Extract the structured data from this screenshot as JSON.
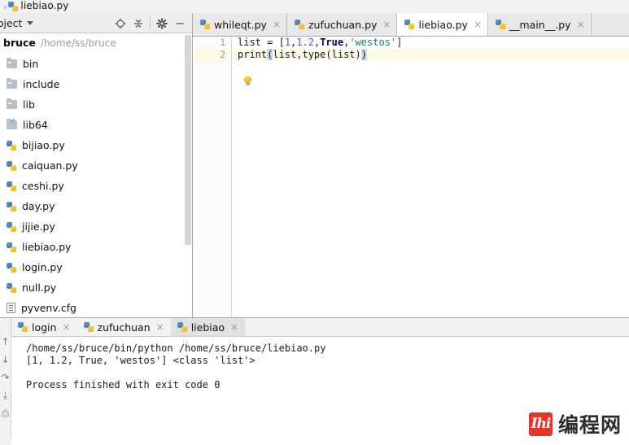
{
  "breadcrumb": {
    "separator": "›",
    "items": [
      {
        "label": "liebiao.py",
        "icon": "python-file-icon"
      }
    ]
  },
  "project_panel": {
    "title": "roject",
    "title_full": "Project",
    "tools": [
      {
        "name": "locate-icon",
        "glyph": "⊕"
      },
      {
        "name": "collapse-all-icon",
        "glyph": "⩒"
      },
      {
        "name": "settings-gear-icon",
        "glyph": "⚙"
      },
      {
        "name": "hide-panel-icon",
        "glyph": "—"
      }
    ],
    "root": {
      "name": "bruce",
      "path": "/home/ss/bruce"
    },
    "items": [
      {
        "label": "bin",
        "icon": "folder-icon"
      },
      {
        "label": "include",
        "icon": "folder-icon"
      },
      {
        "label": "lib",
        "icon": "folder-icon"
      },
      {
        "label": "lib64",
        "icon": "folder-link-icon"
      },
      {
        "label": "bijiao.py",
        "icon": "python-file-icon"
      },
      {
        "label": "caiquan.py",
        "icon": "python-file-icon"
      },
      {
        "label": "ceshi.py",
        "icon": "python-file-icon"
      },
      {
        "label": "day.py",
        "icon": "python-file-icon"
      },
      {
        "label": "jijie.py",
        "icon": "python-file-icon"
      },
      {
        "label": "liebiao.py",
        "icon": "python-file-icon"
      },
      {
        "label": "login.py",
        "icon": "python-file-icon"
      },
      {
        "label": "null.py",
        "icon": "python-file-icon"
      },
      {
        "label": "pyvenv.cfg",
        "icon": "config-file-icon"
      }
    ]
  },
  "editor": {
    "tabs": [
      {
        "label": "whileqt.py",
        "icon": "python-file-icon",
        "active": false,
        "close": "×"
      },
      {
        "label": "zufuchuan.py",
        "icon": "python-file-icon",
        "active": false,
        "close": "×"
      },
      {
        "label": "liebiao.py",
        "icon": "python-file-icon",
        "active": true,
        "close": "×"
      },
      {
        "label": "__main__.py",
        "icon": "python-file-icon",
        "active": false,
        "close": "×"
      }
    ],
    "line_numbers": [
      "1",
      "2"
    ],
    "current_line": 2,
    "lines": [
      {
        "number": "1",
        "tokens": [
          {
            "text": "list ",
            "type": "plain"
          },
          {
            "text": "= ",
            "type": "plain"
          },
          {
            "text": "[",
            "type": "plain"
          },
          {
            "text": "1",
            "type": "number"
          },
          {
            "text": ",",
            "type": "plain"
          },
          {
            "text": "1.2",
            "type": "number"
          },
          {
            "text": ",",
            "type": "plain"
          },
          {
            "text": "True",
            "type": "keyword"
          },
          {
            "text": ",",
            "type": "plain"
          },
          {
            "text": "'westos'",
            "type": "string"
          },
          {
            "text": "]",
            "type": "plain"
          }
        ]
      },
      {
        "number": "2",
        "tokens": [
          {
            "text": "print",
            "type": "plain"
          },
          {
            "text": "(",
            "type": "bracket"
          },
          {
            "text": "list,type",
            "type": "plain"
          },
          {
            "text": "(",
            "type": "plain"
          },
          {
            "text": "list",
            "type": "plain"
          },
          {
            "text": ")",
            "type": "plain"
          },
          {
            "text": ")",
            "type": "bracket"
          }
        ]
      }
    ],
    "intention_bulb": {
      "name": "intention-bulb-icon"
    }
  },
  "console": {
    "tabs": [
      {
        "label": "login",
        "icon": "python-run-icon",
        "active": false,
        "close": "×"
      },
      {
        "label": "zufuchuan",
        "icon": "python-run-icon",
        "active": false,
        "close": "×"
      },
      {
        "label": "liebiao",
        "icon": "python-run-icon",
        "active": true,
        "close": "×"
      }
    ],
    "sidebar_icons": [
      {
        "name": "scroll-up-icon",
        "glyph": "↑"
      },
      {
        "name": "scroll-down-icon",
        "glyph": "↓"
      },
      {
        "name": "soft-wrap-icon",
        "glyph": "↷"
      },
      {
        "name": "scroll-to-end-icon",
        "glyph": "⤓"
      },
      {
        "name": "print-icon",
        "glyph": "⎙"
      }
    ],
    "output": [
      "/home/ss/bruce/bin/python /home/ss/bruce/liebiao.py",
      "[1, 1.2, True, 'westos'] <class 'list'>",
      "",
      "Process finished with exit code 0"
    ]
  },
  "watermark": {
    "mark": "Ihi",
    "text": "编程网"
  },
  "colors": {
    "keyword": "#000080",
    "string": "#0b8a6b",
    "number": "#3a5fcd",
    "bracket_highlight": "#c0dcf0",
    "current_line": "#fdfbe8",
    "panel_bg": "#eeeeee",
    "watermark_red": "#e8332a"
  }
}
